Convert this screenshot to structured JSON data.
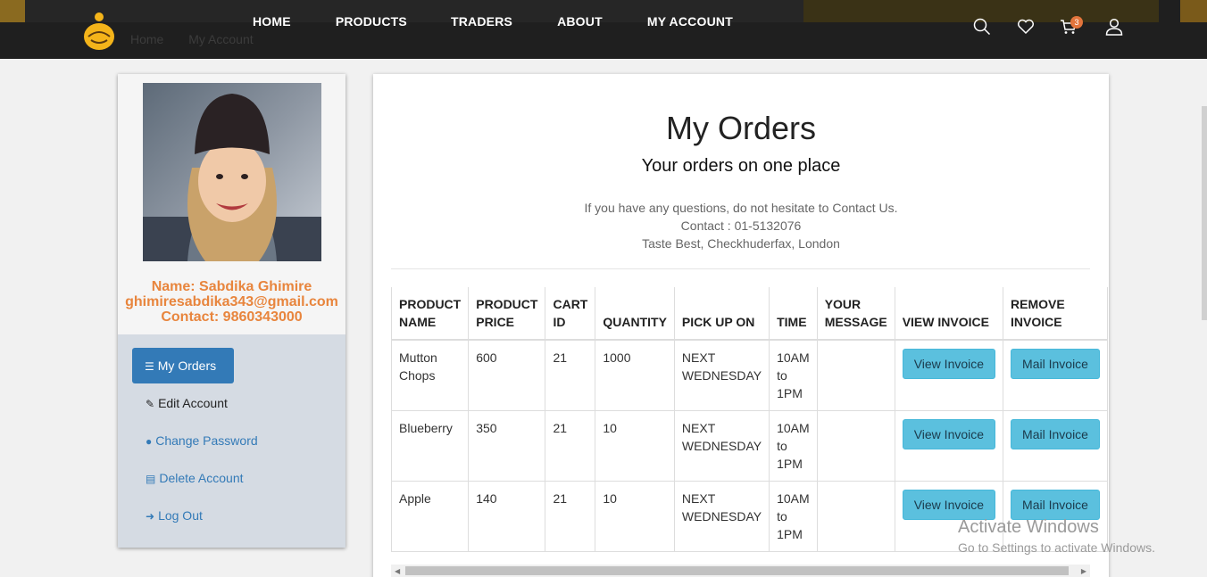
{
  "header": {
    "breadcrumb": [
      "Home",
      "My Account"
    ],
    "nav": [
      "HOME",
      "PRODUCTS",
      "TRADERS",
      "ABOUT",
      "MY ACCOUNT"
    ],
    "cart_count": "3",
    "icons": [
      "search-icon",
      "heart-icon",
      "cart-icon",
      "user-icon"
    ]
  },
  "profile": {
    "name": "Name: Sabdika Ghimire",
    "email": "ghimiresabdika343@gmail.com",
    "contact": "Contact: 9860343000"
  },
  "menu": {
    "my_orders": "My Orders",
    "edit_account": "Edit Account",
    "change_password": "Change Password",
    "delete_account": "Delete Account",
    "log_out": "Log Out"
  },
  "main": {
    "title": "My Orders",
    "subtitle": "Your orders on one place",
    "contact_line1": "If you have any questions, do not hesitate to Contact Us.",
    "contact_line2": "Contact : 01-5132076",
    "contact_line3": "Taste Best, Checkhuderfax, London"
  },
  "table": {
    "headers": [
      "PRODUCT NAME",
      "PRODUCT PRICE",
      "CART ID",
      "QUANTITY",
      "PICK UP ON",
      "TIME",
      "YOUR MESSAGE",
      "VIEW INVOICE",
      "REMOVE INVOICE"
    ],
    "rows": [
      {
        "name": "Mutton Chops",
        "price": "600",
        "cart": "21",
        "qty": "1000",
        "pickup": "NEXT WEDNESDAY",
        "time": "10AM to 1PM",
        "message": "",
        "view": "View Invoice",
        "mail": "Mail Invoice"
      },
      {
        "name": "Blueberry",
        "price": "350",
        "cart": "21",
        "qty": "10",
        "pickup": "NEXT WEDNESDAY",
        "time": "10AM to 1PM",
        "message": "",
        "view": "View Invoice",
        "mail": "Mail Invoice"
      },
      {
        "name": "Apple",
        "price": "140",
        "cart": "21",
        "qty": "10",
        "pickup": "NEXT WEDNESDAY",
        "time": "10AM to 1PM",
        "message": "",
        "view": "View Invoice",
        "mail": "Mail Invoice"
      }
    ]
  },
  "watermark": {
    "line1": "Activate Windows",
    "line2": "Go to Settings to activate Windows."
  },
  "colors": {
    "accent": "#337ab7",
    "profile_text": "#e8853d",
    "info_button": "#5bc0de",
    "header_bg": "#1f1f1f"
  }
}
